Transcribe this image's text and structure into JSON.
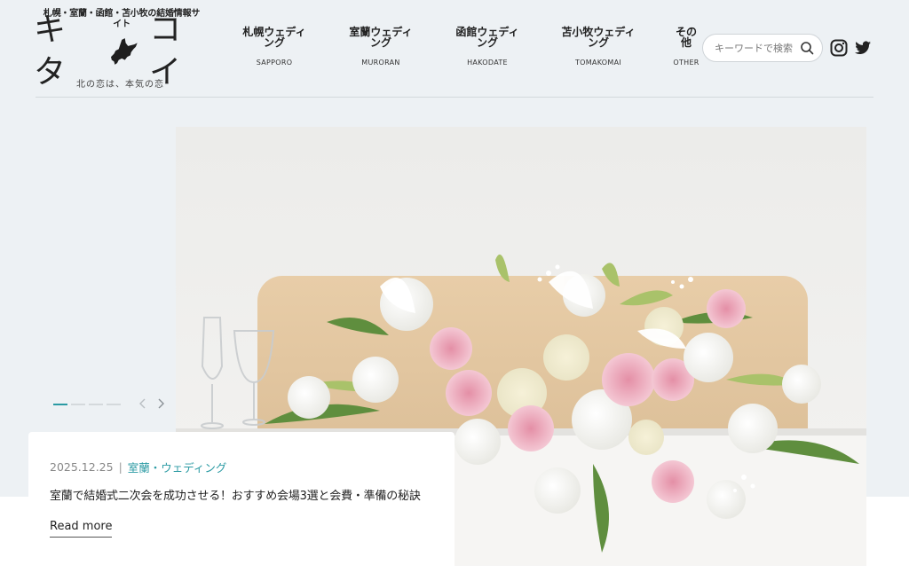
{
  "header": {
    "tagline": "札幌・室蘭・函館・苫小牧の結婚情報サイト",
    "logo_left": "キタ",
    "logo_right": "コイ",
    "logo_sub": "北の恋は、本気の恋"
  },
  "nav": [
    {
      "ja": "札幌ウェディング",
      "en": "SAPPORO"
    },
    {
      "ja": "室蘭ウェディング",
      "en": "MURORAN"
    },
    {
      "ja": "函館ウェディング",
      "en": "HAKODATE"
    },
    {
      "ja": "苫小牧ウェディング",
      "en": "TOMAKOMAI"
    },
    {
      "ja": "その他",
      "en": "OTHER"
    }
  ],
  "search": {
    "placeholder": "キーワードで検索"
  },
  "icons": {
    "search": "search-icon",
    "instagram": "instagram-icon",
    "twitter": "twitter-icon",
    "prev": "chevron-left-icon",
    "next": "chevron-right-icon"
  },
  "colors": {
    "background": "#edf1f4",
    "accent": "#2a9aa3"
  },
  "slider": {
    "count": 4,
    "active": 0
  },
  "post": {
    "date": "2025.12.25",
    "separator": "|",
    "category": "室蘭・ウェディング",
    "title": "室蘭で結婚式二次会を成功させる！おすすめ会場3選と会費・準備の秘訣",
    "read_more": "Read more"
  }
}
